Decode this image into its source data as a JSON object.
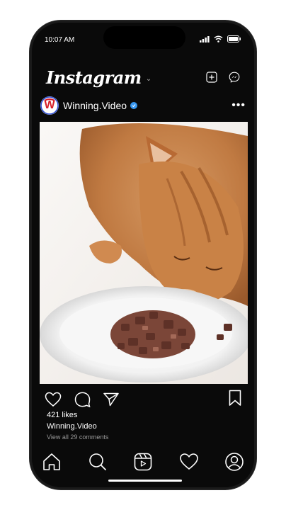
{
  "status_bar": {
    "time": "10:07 AM"
  },
  "header": {
    "logo": "Instagram",
    "icons": [
      "chevron-down-icon",
      "new-post-icon",
      "messenger-icon"
    ]
  },
  "post": {
    "avatar_letter": "W",
    "username": "Winning.Video",
    "verified": true,
    "more_label": "•••",
    "image": "orange tabby cat eating wet food from a white plate",
    "likes": "421 likes",
    "caption_user": "Winning.Video",
    "view_comments": "View all 29 comments"
  },
  "actions": [
    "heart-icon",
    "comment-icon",
    "share-icon",
    "bookmark-icon"
  ],
  "bottom_nav": [
    "home-icon",
    "search-icon",
    "reels-icon",
    "activity-icon",
    "profile-icon"
  ],
  "colors": {
    "background": "#0a0a0a",
    "text": "#ffffff",
    "verified": "#3897f0",
    "brand_red": "#d6202a"
  }
}
